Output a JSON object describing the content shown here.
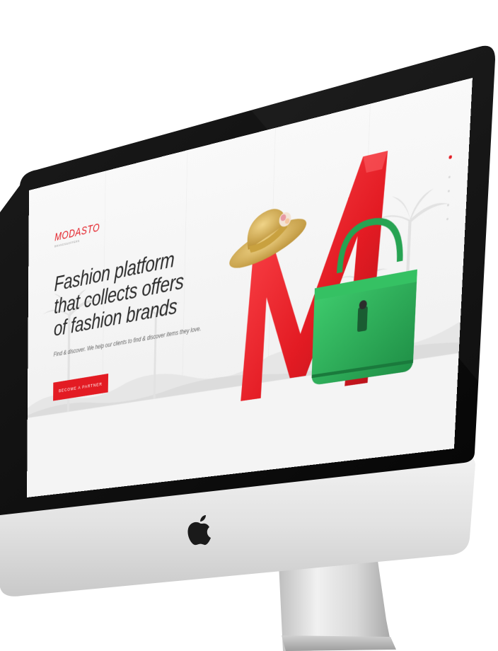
{
  "device": {
    "type": "imac",
    "bezel_color": "#0b0b0b",
    "chin_color": "#e6e6e6",
    "logo": "apple-logo"
  },
  "site": {
    "logo_text": "MODASTO",
    "logo_tagline": "BRANDS&OFFERS",
    "headline_lines": [
      "Fashion platform",
      "that collects offers",
      "of fashion brands"
    ],
    "subtext": "Find & discover. We help our clients to find & discover items they love.",
    "cta_label": "BECOME A PARTNER",
    "brand_color": "#e31b23",
    "bag_color": "#2cb25b",
    "hat_color": "#d9b45a"
  }
}
